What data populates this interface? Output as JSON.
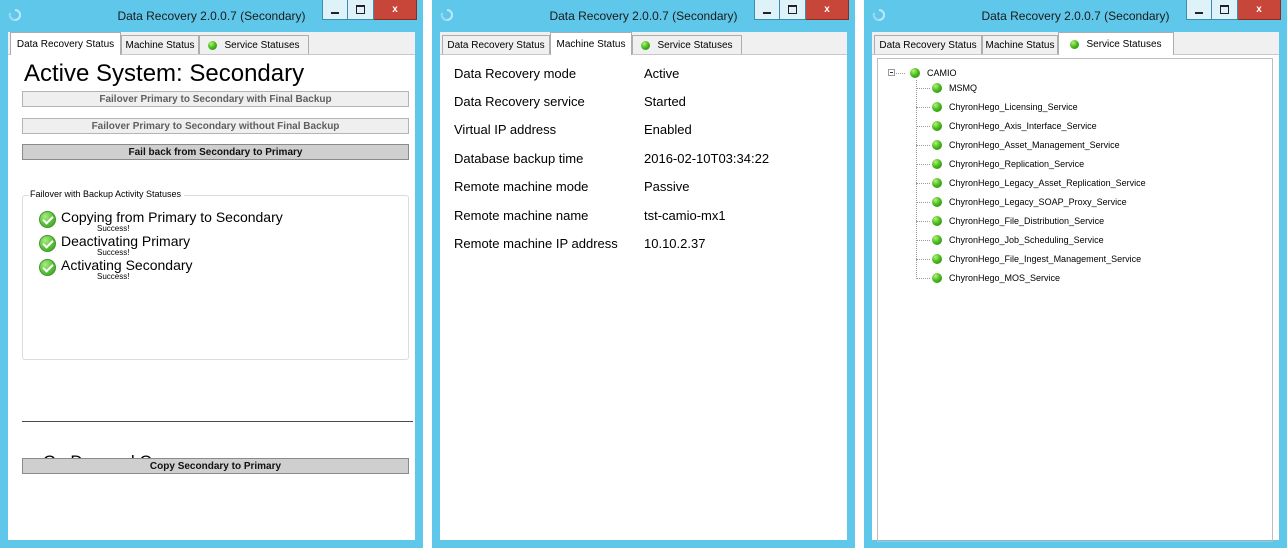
{
  "app": {
    "title": "Data Recovery 2.0.0.7 (Secondary)",
    "icon": "app-recovery-icon",
    "close_glyph": "x"
  },
  "tabs": {
    "data_recovery_status": "Data Recovery Status",
    "machine_status": "Machine Status",
    "service_statuses": "Service Statuses"
  },
  "data_recovery": {
    "active_system": "Active System:  Secondary",
    "buttons": {
      "failover_with_backup": "Failover Primary to Secondary with Final Backup",
      "failover_without_backup": "Failover Primary to Secondary without Final Backup",
      "fail_back": "Fail back from Secondary to Primary"
    },
    "activity": {
      "legend": "Failover with Backup Activity Statuses",
      "steps": [
        {
          "label": "Copying from Primary to Secondary",
          "status": "Success!"
        },
        {
          "label": "Deactivating Primary",
          "status": "Success!"
        },
        {
          "label": "Activating Secondary",
          "status": "Success!"
        }
      ]
    },
    "on_demand": {
      "title": "On Demand Copy",
      "button": "Copy Secondary to Primary"
    }
  },
  "machine_status": {
    "rows": [
      {
        "label": "Data Recovery mode",
        "value": "Active"
      },
      {
        "label": "Data Recovery service",
        "value": "Started"
      },
      {
        "label": "Virtual IP address",
        "value": "Enabled"
      },
      {
        "label": "Database backup time",
        "value": "2016-02-10T03:34:22"
      },
      {
        "label": "Remote machine mode",
        "value": "Passive"
      },
      {
        "label": "Remote machine name",
        "value": "tst-camio-mx1"
      },
      {
        "label": "Remote machine IP address",
        "value": "10.10.2.37"
      }
    ]
  },
  "service_statuses": {
    "root": {
      "label": "CAMIO",
      "status": "running"
    },
    "services": [
      {
        "label": "MSMQ",
        "status": "running"
      },
      {
        "label": "ChyronHego_Licensing_Service",
        "status": "running"
      },
      {
        "label": "ChyronHego_Axis_Interface_Service",
        "status": "running"
      },
      {
        "label": "ChyronHego_Asset_Management_Service",
        "status": "running"
      },
      {
        "label": "ChyronHego_Replication_Service",
        "status": "running"
      },
      {
        "label": "ChyronHego_Legacy_Asset_Replication_Service",
        "status": "running"
      },
      {
        "label": "ChyronHego_Legacy_SOAP_Proxy_Service",
        "status": "running"
      },
      {
        "label": "ChyronHego_File_Distribution_Service",
        "status": "running"
      },
      {
        "label": "ChyronHego_Job_Scheduling_Service",
        "status": "running"
      },
      {
        "label": "ChyronHego_File_Ingest_Management_Service",
        "status": "running"
      },
      {
        "label": "ChyronHego_MOS_Service",
        "status": "running"
      }
    ]
  },
  "colors": {
    "window_frame": "#5fc7ea",
    "close_button": "#c74639",
    "status_ok": "#4cbf1e"
  }
}
